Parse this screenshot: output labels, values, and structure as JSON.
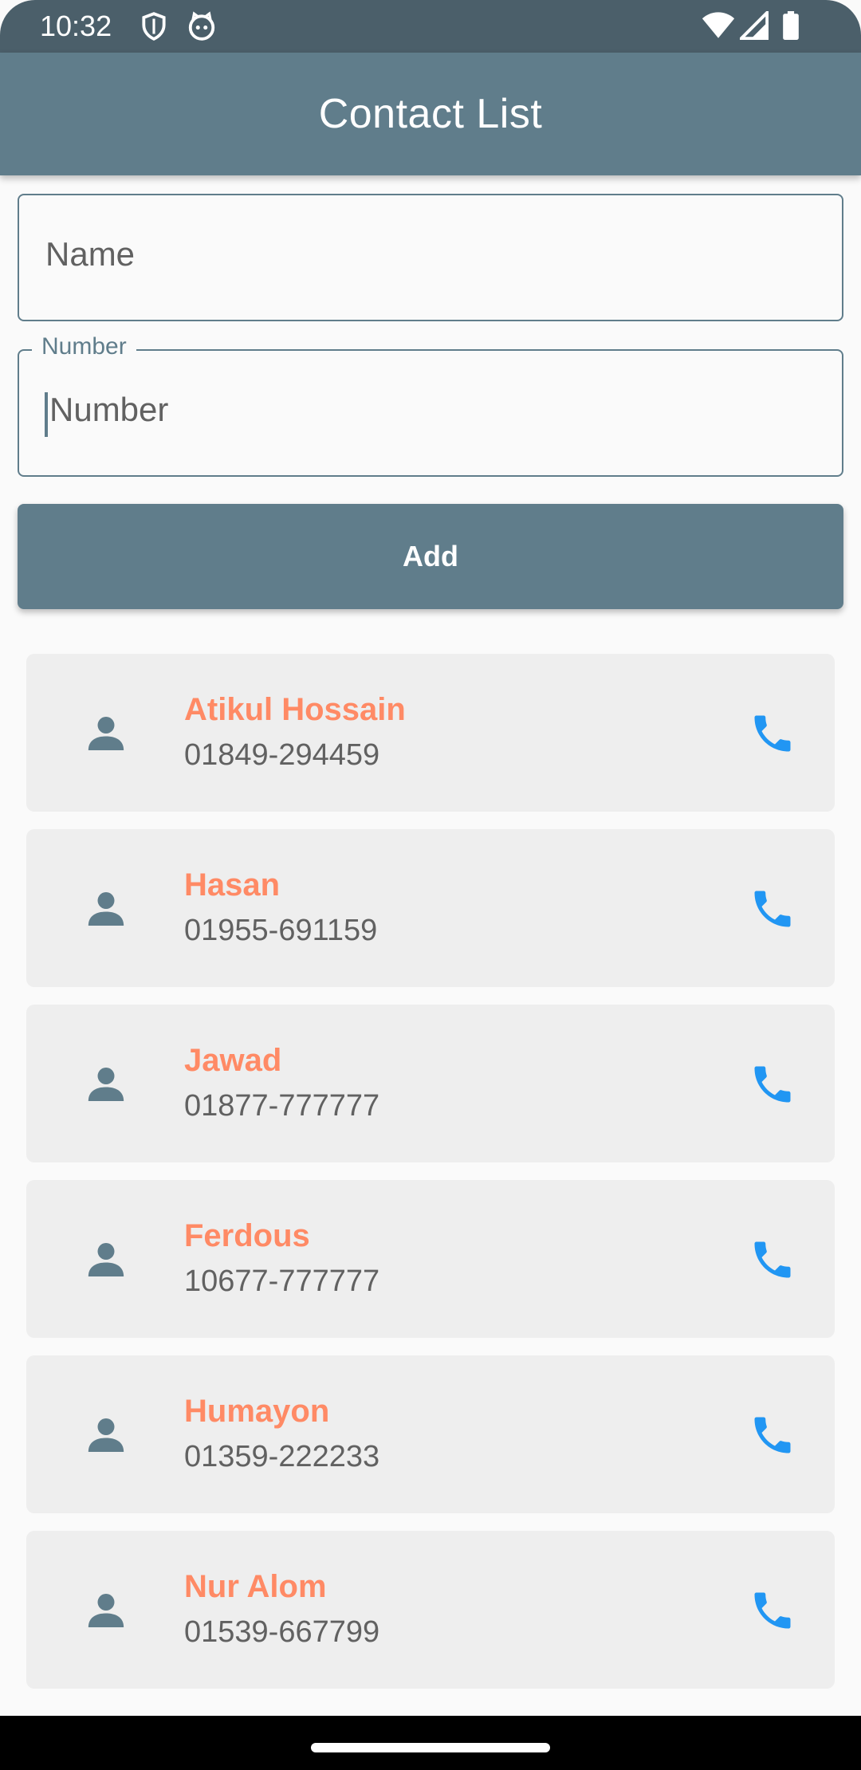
{
  "status_bar": {
    "time": "10:32",
    "icons_left": [
      "shield-icon",
      "cat-icon"
    ],
    "icons_right": [
      "wifi-icon",
      "signal-icon",
      "battery-icon"
    ]
  },
  "app_bar": {
    "title": "Contact List"
  },
  "form": {
    "name_placeholder": "Name",
    "number_label": "Number",
    "number_placeholder": "Number",
    "add_label": "Add"
  },
  "contacts": [
    {
      "name": "Atikul Hossain",
      "number": "01849-294459"
    },
    {
      "name": "Hasan",
      "number": "01955-691159"
    },
    {
      "name": "Jawad",
      "number": "01877-777777"
    },
    {
      "name": "Ferdous",
      "number": "10677-777777"
    },
    {
      "name": "Humayon",
      "number": "01359-222233"
    },
    {
      "name": "Nur Alom",
      "number": "01539-667799"
    }
  ],
  "colors": {
    "primary": "#607d8b",
    "status_bar": "#4b5f6a",
    "name_accent": "#ff8a65",
    "call_icon": "#2196f3",
    "card_bg": "#eeeeee"
  }
}
